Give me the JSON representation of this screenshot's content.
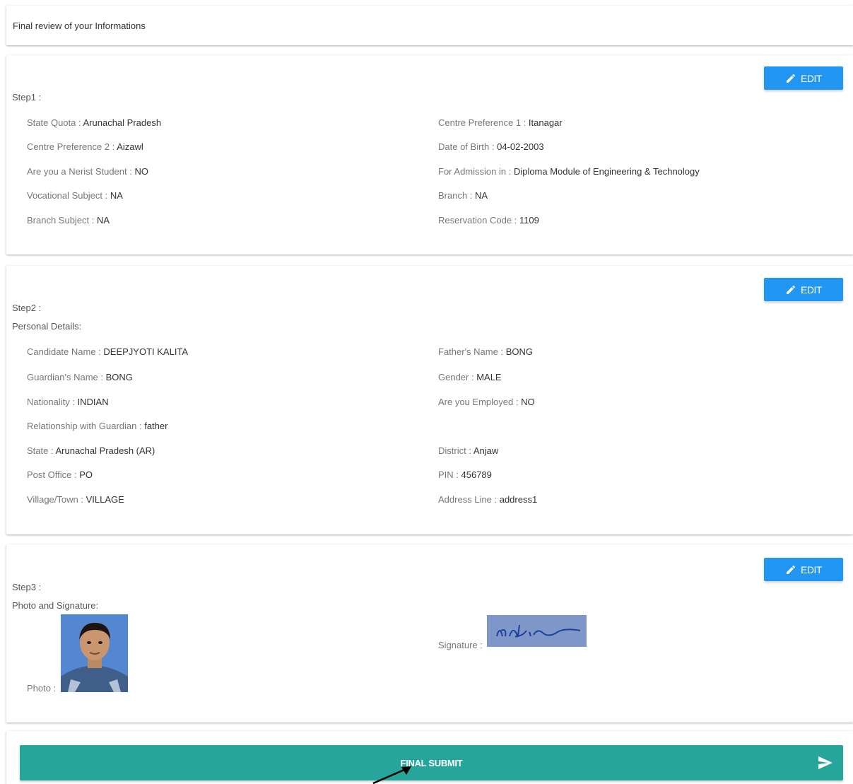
{
  "header": {
    "title": "Final review of your Informations"
  },
  "edit_label": "EDIT",
  "step1": {
    "title": "Step1 :",
    "fields": [
      {
        "label": "State Quota : ",
        "value": "Arunachal Pradesh"
      },
      {
        "label": "Centre Preference 1 : ",
        "value": "Itanagar"
      },
      {
        "label": "Centre Preference 2 : ",
        "value": "Aizawl"
      },
      {
        "label": "Date of Birth : ",
        "value": "04-02-2003"
      },
      {
        "label": "Are you a Nerist Student : ",
        "value": "NO"
      },
      {
        "label": "For Admission in : ",
        "value": "Diploma Module of Engineering & Technology"
      },
      {
        "label": "Vocational Subject : ",
        "value": "NA"
      },
      {
        "label": "Branch : ",
        "value": "NA"
      },
      {
        "label": "Branch Subject : ",
        "value": "NA"
      },
      {
        "label": "Reservation Code : ",
        "value": "1109"
      }
    ]
  },
  "step2": {
    "title": "Step2 :",
    "section": "Personal Details:",
    "fields": [
      {
        "label": "Candidate Name : ",
        "value": "DEEPJYOTI KALITA"
      },
      {
        "label": "Father's Name : ",
        "value": "BONG"
      },
      {
        "label": "Guardian's Name : ",
        "value": "BONG"
      },
      {
        "label": "Gender : ",
        "value": "MALE"
      },
      {
        "label": "Nationality : ",
        "value": "INDIAN"
      },
      {
        "label": "Are you Employed : ",
        "value": "NO"
      },
      {
        "label": "Relationship with Guardian : ",
        "value": "father"
      },
      {
        "label": "State : ",
        "value": "Arunachal Pradesh (AR)"
      },
      {
        "label": "District : ",
        "value": "Anjaw"
      },
      {
        "label": "Post Office : ",
        "value": "PO"
      },
      {
        "label": "PIN : ",
        "value": "456789"
      },
      {
        "label": "Village/Town : ",
        "value": "VILLAGE"
      },
      {
        "label": "Address Line : ",
        "value": "address1"
      }
    ]
  },
  "step3": {
    "title": "Step3 :",
    "section": "Photo and Signature:",
    "photo_label": "Photo : ",
    "signature_label": "Signature : ",
    "signature_text": "Kdl.t.c"
  },
  "submit": {
    "label": "FINAL SUBMIT"
  },
  "colors": {
    "edit": "#2196f3",
    "submit": "#26a69a"
  },
  "icons": {
    "edit": "pencil-icon",
    "submit": "send-icon",
    "annotation": "arrow-icon"
  }
}
